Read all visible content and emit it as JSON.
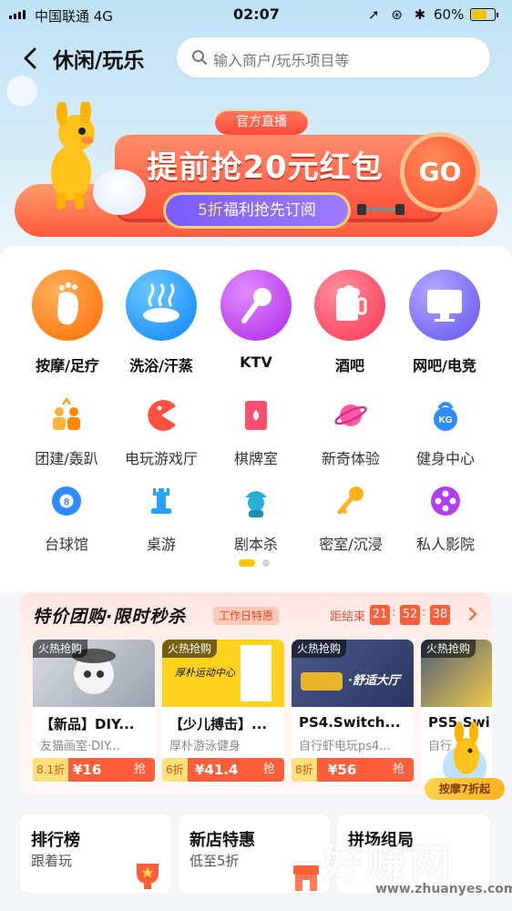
{
  "status_bar": {
    "carrier": "中国联通  4G",
    "time": "02:07",
    "icons": "➚ ⊛ ✱",
    "battery": "60%"
  },
  "header": {
    "title": "休闲/玩乐",
    "search_placeholder": "输入商户/玩乐项目等"
  },
  "banner": {
    "tag": "官方直播",
    "headline": "提前抢20元红包",
    "pill_highlight": "5折",
    "pill_rest": "福利抢先订阅",
    "go": "GO"
  },
  "categories_main": [
    {
      "label": "按摩/足疗",
      "icon": "foot-icon",
      "color": "#ff7a1a"
    },
    {
      "label": "洗浴/汗蒸",
      "icon": "hot-spring-icon",
      "color": "#1e9bff"
    },
    {
      "label": "KTV",
      "icon": "microphone-icon",
      "color": "#c13df2"
    },
    {
      "label": "酒吧",
      "icon": "beer-icon",
      "color": "#ff5169"
    },
    {
      "label": "网吧/电竞",
      "icon": "monitor-icon",
      "color": "#7a6cf5"
    }
  ],
  "categories_more": [
    {
      "label": "团建/轰趴",
      "icon": "team-icon"
    },
    {
      "label": "电玩游戏厅",
      "icon": "pacman-icon"
    },
    {
      "label": "棋牌室",
      "icon": "playing-card-icon"
    },
    {
      "label": "新奇体验",
      "icon": "planet-icon"
    },
    {
      "label": "健身中心",
      "icon": "kettlebell-icon",
      "kettlebell_text": "KG"
    },
    {
      "label": "台球馆",
      "icon": "billiard-ball-icon",
      "ball_number": "8"
    },
    {
      "label": "桌游",
      "icon": "chess-rook-icon"
    },
    {
      "label": "剧本杀",
      "icon": "detective-icon"
    },
    {
      "label": "密室/沉浸",
      "icon": "key-icon"
    },
    {
      "label": "私人影院",
      "icon": "film-reel-icon"
    }
  ],
  "deals": {
    "title": "特价团购·限时秒杀",
    "tag": "工作日特惠",
    "countdown_label": "距结束",
    "countdown": [
      "21",
      "52",
      "38"
    ],
    "items": [
      {
        "hot": "火热抢购",
        "name": "【新品】DIY...",
        "shop": "友猫画室·DIY...",
        "discount": "8.1折",
        "price": "¥16",
        "grab": "抢",
        "img_text": ""
      },
      {
        "hot": "火热抢购",
        "name": "【少儿搏击】...",
        "shop": "厚朴游泳健身",
        "discount": "6折",
        "price": "¥41.4",
        "grab": "抢",
        "img_text": "厚朴运动中心"
      },
      {
        "hot": "火热抢购",
        "name": "PS4.Switch...",
        "shop": "自行虾电玩ps4...",
        "discount": "8折",
        "price": "¥56",
        "grab": "抢",
        "img_text": "·舒适大厅"
      },
      {
        "hot": "火热抢购",
        "name": "PS5.Swi",
        "shop": "自行",
        "discount": "",
        "price": "",
        "grab": "",
        "img_text": ""
      }
    ]
  },
  "float_promo": {
    "label": "按摩7折起"
  },
  "bottom_cards": [
    {
      "title": "排行榜",
      "subtitle": "跟着玩"
    },
    {
      "title": "新店特惠",
      "subtitle": "低至5折"
    },
    {
      "title": "拼场组局",
      "subtitle": ""
    }
  ],
  "watermark": {
    "text": "好赚网",
    "url": "www.zhuanyes.com"
  },
  "colors": {
    "accent_orange": "#ff5e3a",
    "brand_yellow": "#ffc400",
    "deal_tag": "#e0502c"
  }
}
